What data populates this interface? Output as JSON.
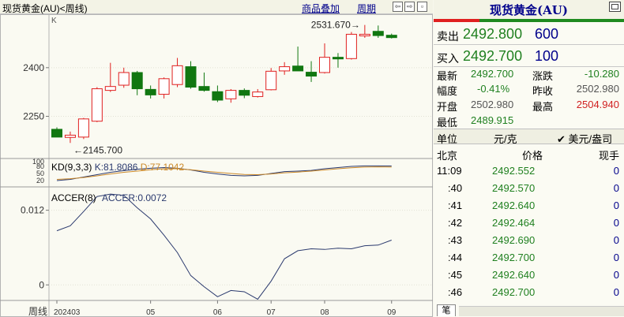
{
  "chart_panel": {
    "title": "现货黄金(AU)<周线)",
    "link_combine": "商品叠加",
    "link_period": "周期",
    "k_label": "K",
    "kd": {
      "label": "KD(9,3,3)",
      "k_text": "K:81.8086",
      "d_text": "D:77.1042",
      "y_ticks": [
        "100",
        "80",
        "50",
        "20"
      ]
    },
    "accer": {
      "label": "ACCER(8)",
      "value_text": "ACCER:0.0072",
      "y_ticks": [
        "0.012",
        "0"
      ]
    },
    "bottom_label": "周线",
    "x_ticks": [
      "202403",
      "05",
      "06",
      "07",
      "08",
      "09"
    ],
    "annotations": {
      "high": "2531.670→",
      "low": "←2145.700"
    },
    "colors": {
      "up": "#e02020",
      "down": "#117711",
      "kd_k": "#2b3a6e",
      "kd_d": "#cc8a2a",
      "accer": "#2b3a6e"
    }
  },
  "chart_data": [
    {
      "type": "candlestick",
      "title": "",
      "ylabel": "",
      "y_ticks": [
        2250,
        2400
      ],
      "ylim": [
        2120,
        2560
      ],
      "candles": [
        {
          "o": 2210,
          "h": 2216,
          "l": 2188,
          "c": 2186
        },
        {
          "o": 2185,
          "h": 2203,
          "l": 2168,
          "c": 2192
        },
        {
          "o": 2186,
          "h": 2245,
          "l": 2180,
          "c": 2242
        },
        {
          "o": 2235,
          "h": 2340,
          "l": 2232,
          "c": 2335
        },
        {
          "o": 2330,
          "h": 2415,
          "l": 2325,
          "c": 2342
        },
        {
          "o": 2346,
          "h": 2400,
          "l": 2338,
          "c": 2385
        },
        {
          "o": 2385,
          "h": 2390,
          "l": 2315,
          "c": 2335
        },
        {
          "o": 2333,
          "h": 2345,
          "l": 2305,
          "c": 2316
        },
        {
          "o": 2318,
          "h": 2370,
          "l": 2305,
          "c": 2366
        },
        {
          "o": 2348,
          "h": 2430,
          "l": 2340,
          "c": 2406
        },
        {
          "o": 2403,
          "h": 2420,
          "l": 2335,
          "c": 2340
        },
        {
          "o": 2342,
          "h": 2385,
          "l": 2326,
          "c": 2330
        },
        {
          "o": 2326,
          "h": 2345,
          "l": 2294,
          "c": 2300
        },
        {
          "o": 2304,
          "h": 2334,
          "l": 2292,
          "c": 2330
        },
        {
          "o": 2330,
          "h": 2336,
          "l": 2306,
          "c": 2315
        },
        {
          "o": 2311,
          "h": 2334,
          "l": 2308,
          "c": 2325
        },
        {
          "o": 2332,
          "h": 2399,
          "l": 2330,
          "c": 2389
        },
        {
          "o": 2390,
          "h": 2417,
          "l": 2378,
          "c": 2403
        },
        {
          "o": 2405,
          "h": 2465,
          "l": 2398,
          "c": 2390
        },
        {
          "o": 2386,
          "h": 2420,
          "l": 2356,
          "c": 2374
        },
        {
          "o": 2385,
          "h": 2475,
          "l": 2382,
          "c": 2432
        },
        {
          "o": 2432,
          "h": 2445,
          "l": 2400,
          "c": 2427
        },
        {
          "o": 2428,
          "h": 2510,
          "l": 2425,
          "c": 2503
        },
        {
          "o": 2498,
          "h": 2531.67,
          "l": 2492,
          "c": 2503
        },
        {
          "o": 2512,
          "h": 2530,
          "l": 2492,
          "c": 2499
        },
        {
          "o": 2500,
          "h": 2505,
          "l": 2489.9,
          "c": 2492.7
        }
      ]
    },
    {
      "type": "line",
      "title": "KD(9,3,3)",
      "ylim": [
        0,
        100
      ],
      "series": [
        {
          "name": "K",
          "values": [
            20,
            25,
            35,
            45,
            55,
            62,
            68,
            72,
            75,
            72,
            65,
            55,
            48,
            42,
            40,
            42,
            50,
            58,
            60,
            63,
            70,
            75,
            80,
            82,
            82,
            81.8086
          ]
        },
        {
          "name": "D",
          "values": [
            25,
            28,
            33,
            40,
            48,
            55,
            60,
            66,
            70,
            70,
            66,
            60,
            55,
            50,
            46,
            45,
            48,
            53,
            56,
            60,
            65,
            70,
            74,
            77,
            78,
            77.1042
          ]
        }
      ]
    },
    {
      "type": "line",
      "title": "ACCER(8)",
      "ylim": [
        -0.0025,
        0.0155
      ],
      "series": [
        {
          "name": "ACCER",
          "values": [
            0.0087,
            0.0095,
            0.0118,
            0.0142,
            0.0146,
            0.0144,
            0.0124,
            0.0106,
            0.008,
            0.0052,
            0.0015,
            -0.0003,
            -0.0019,
            -0.0009,
            -0.0011,
            -0.0023,
            0.0006,
            0.0042,
            0.0055,
            0.0058,
            0.0057,
            0.0059,
            0.0058,
            0.0063,
            0.0064,
            0.0072
          ]
        }
      ]
    }
  ],
  "quote_panel": {
    "title": "现货黄金(AU)",
    "sell": {
      "label": "卖出",
      "price": "2492.800",
      "volume": "600"
    },
    "buy": {
      "label": "买入",
      "price": "2492.700",
      "volume": "100"
    },
    "stats": [
      {
        "label": "最新",
        "value": "2492.700",
        "label2": "涨跌",
        "value2": "-10.280"
      },
      {
        "label": "幅度",
        "value": "-0.41%",
        "label2": "昨收",
        "value2": "2502.980"
      },
      {
        "label": "开盘",
        "value": "2502.980",
        "label2": "最高",
        "value2": "2504.940"
      },
      {
        "label": "最低",
        "value": "2489.915",
        "label2": "",
        "value2": ""
      }
    ],
    "unit_label": "单位",
    "unit_value": "元/克",
    "unit_option": "✔ 美元/盎司",
    "tick_header": {
      "place": "北京",
      "price": "价格",
      "volume": "现手"
    },
    "ticks": [
      {
        "time": "11:09",
        "price": "2492.552",
        "vol": "0"
      },
      {
        "time": ":40",
        "price": "2492.570",
        "vol": "0"
      },
      {
        "time": ":41",
        "price": "2492.640",
        "vol": "0"
      },
      {
        "time": ":42",
        "price": "2492.464",
        "vol": "0"
      },
      {
        "time": ":43",
        "price": "2492.690",
        "vol": "0"
      },
      {
        "time": ":44",
        "price": "2492.700",
        "vol": "0"
      },
      {
        "time": ":45",
        "price": "2492.640",
        "vol": "0"
      },
      {
        "time": ":46",
        "price": "2492.700",
        "vol": "0"
      }
    ],
    "tab_label": "笔"
  }
}
